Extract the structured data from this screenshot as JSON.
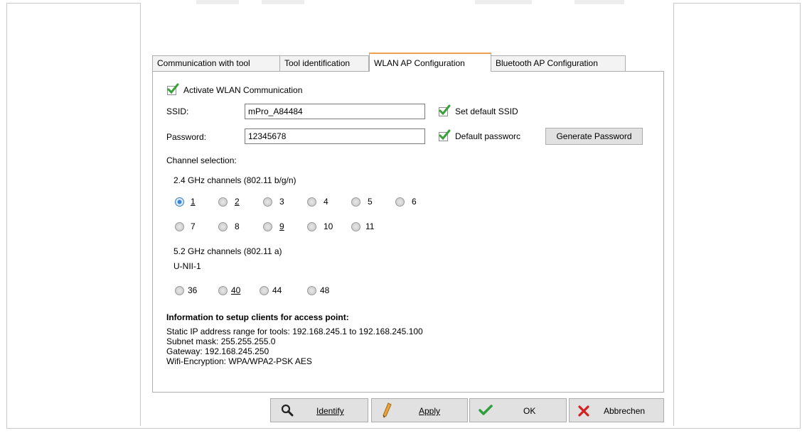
{
  "tabs": [
    {
      "label": "Communication with tool",
      "active": false
    },
    {
      "label": "Tool identification",
      "active": false
    },
    {
      "label": "WLAN AP Configuration",
      "active": true
    },
    {
      "label": "Bluetooth AP Configuration",
      "active": false
    }
  ],
  "activate_wlan": {
    "label": "Activate WLAN Communication",
    "checked": true
  },
  "ssid": {
    "label": "SSID:",
    "value": "mPro_A84484",
    "default_label": "Set default SSID",
    "default_checked": true
  },
  "password": {
    "label": "Password:",
    "value": "12345678",
    "default_label": "Default passworc",
    "default_checked": true,
    "generate_label": "Generate Password"
  },
  "channel_selection": {
    "heading": "Channel selection:",
    "band24_label": "2.4 GHz channels (802.11 b/g/n)",
    "band24_row1": [
      "1",
      "2",
      "3",
      "4",
      "5",
      "6"
    ],
    "band24_row2": [
      "7",
      "8",
      "9",
      "10",
      "11"
    ],
    "band5_label": "5.2 GHz channels (802.11 a)",
    "band5_sub": "U-NII-1",
    "band5_channels": [
      "36",
      "40",
      "44",
      "48"
    ],
    "selected": "1"
  },
  "info": {
    "heading": "Information to setup clients for access point:",
    "lines": [
      "Static IP address range for tools: 192.168.245.1 to 192.168.245.100",
      "Subnet mask: 255.255.255.0",
      "Gateway: 192.168.245.250",
      "Wifi-Encryption: WPA/WPA2-PSK AES"
    ]
  },
  "buttons": {
    "identify": "Identify",
    "apply": "Apply",
    "ok": "OK",
    "cancel": "Abbrechen"
  },
  "colors": {
    "accent_tab": "#f0a050",
    "check_green": "#3aa03a",
    "cancel_red": "#d42020",
    "ok_green": "#2e9e3e"
  }
}
